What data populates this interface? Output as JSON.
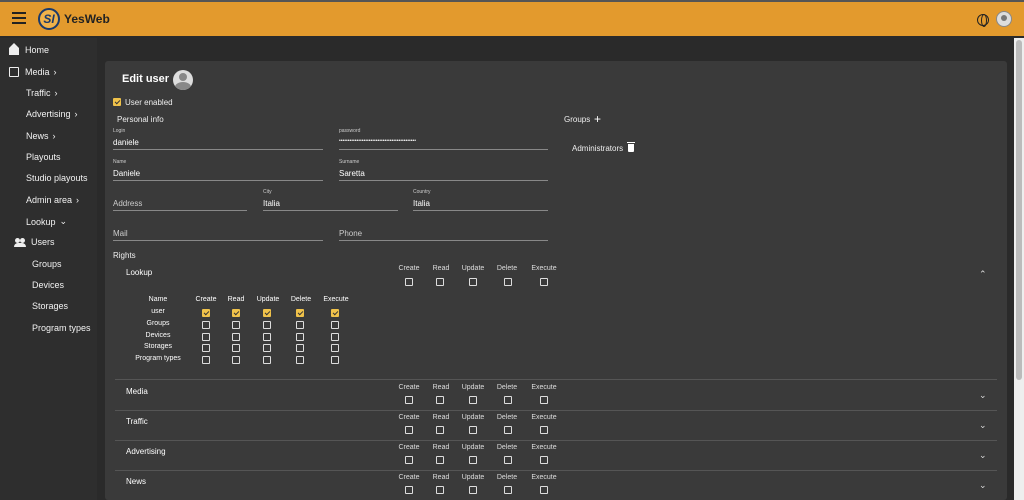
{
  "app": {
    "name": "YesWeb",
    "logo_text": "SI"
  },
  "sidebar": {
    "home": "Home",
    "media": "Media",
    "traffic": "Traffic",
    "advertising": "Advertising",
    "news": "News",
    "playouts": "Playouts",
    "studio_playouts": "Studio playouts",
    "admin_area": "Admin area",
    "lookup": "Lookup",
    "users": "Users",
    "groups": "Groups",
    "devices": "Devices",
    "storages": "Storages",
    "program_types": "Program types"
  },
  "form": {
    "title": "Edit user",
    "user_enabled": "User enabled",
    "user_enabled_checked": true,
    "personal_info": "Personal info",
    "login_label": "Login",
    "login_value": "daniele",
    "password_label": "password",
    "password_value": "••••••••••••••••••••••••••••••••••••••••••••",
    "name_label": "Name",
    "name_value": "Daniele",
    "surname_label": "Surname",
    "surname_value": "Saretta",
    "address_placeholder": "Address",
    "city_label": "City",
    "city_value": "Italia",
    "country_label": "Country",
    "country_value": "Italia",
    "mail_placeholder": "Mail",
    "phone_placeholder": "Phone"
  },
  "groups": {
    "title": "Groups",
    "items": [
      "Administrators"
    ]
  },
  "rights": {
    "title": "Rights",
    "perm_headers": [
      "Create",
      "Read",
      "Update",
      "Delete",
      "Execute"
    ],
    "name_header": "Name",
    "sections": [
      {
        "name": "Lookup",
        "expanded": true,
        "rows": [
          {
            "name": "user",
            "checked": [
              true,
              true,
              true,
              true,
              true
            ]
          },
          {
            "name": "Groups",
            "checked": [
              false,
              false,
              false,
              false,
              false
            ]
          },
          {
            "name": "Devices",
            "checked": [
              false,
              false,
              false,
              false,
              false
            ]
          },
          {
            "name": "Storages",
            "checked": [
              false,
              false,
              false,
              false,
              false
            ]
          },
          {
            "name": "Program types",
            "checked": [
              false,
              false,
              false,
              false,
              false
            ]
          }
        ]
      },
      {
        "name": "Media",
        "expanded": false
      },
      {
        "name": "Traffic",
        "expanded": false
      },
      {
        "name": "Advertising",
        "expanded": false
      },
      {
        "name": "News",
        "expanded": false
      }
    ]
  }
}
